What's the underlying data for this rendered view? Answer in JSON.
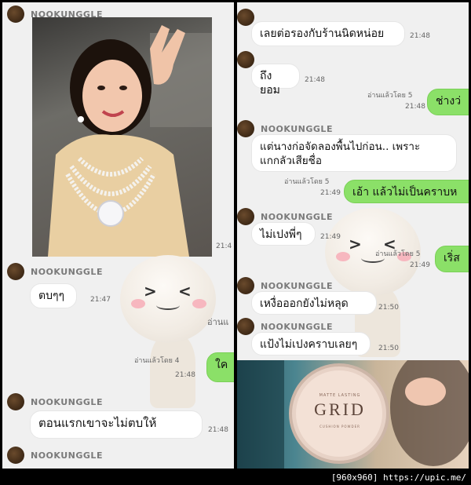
{
  "sender": "NOOKUNGGLE",
  "left": {
    "photo_time": "21:4",
    "msg1": {
      "text": "ตบๆๆ",
      "time": "21:47"
    },
    "read_partial": "อ่านแ",
    "sent1": {
      "read": "อ่านแล้วโดย 4",
      "time": "21:48",
      "text": "ใค"
    },
    "msg2": {
      "text": "ตอนแรกเขาจะไม่ตบให้",
      "time": "21:48"
    }
  },
  "right": {
    "msg1": {
      "text": "เลยต่อรองกับร้านนิดหน่อย",
      "time": "21:48"
    },
    "msg2": {
      "text": "ถึงยอม",
      "time": "21:48"
    },
    "sent1": {
      "read": "อ่านแล้วโดย 5",
      "time": "21:48",
      "text": "ช่างว่"
    },
    "msg3": {
      "line1": "แต่นางก่อจัดลองพื้นไปก่อน.. เพราะ",
      "line2": "แกกลัวเสียชื่อ"
    },
    "sent2": {
      "read": "อ่านแล้วโดย 5",
      "time": "21:49",
      "text": "เอ้า แล้วไม่เป็นคราบห"
    },
    "msg4": {
      "text": "ไม่เปงพี่ๆ",
      "time": "21:49"
    },
    "sent3": {
      "read": "อ่านแล้วโดย 5",
      "time": "21:49",
      "text": "เริ่ส"
    },
    "msg5": {
      "text": "เหงื่อออกยังไม่หลุด",
      "time": "21:50"
    },
    "msg6": {
      "text": "แป้งไม่เปงคราบเลยๆ",
      "time": "21:50"
    },
    "product": {
      "brand": "GRID",
      "top": "MATTE LASTING",
      "bottom": "CUSHION POWDER"
    }
  },
  "watermark": "[960x960] https://upic.me/"
}
